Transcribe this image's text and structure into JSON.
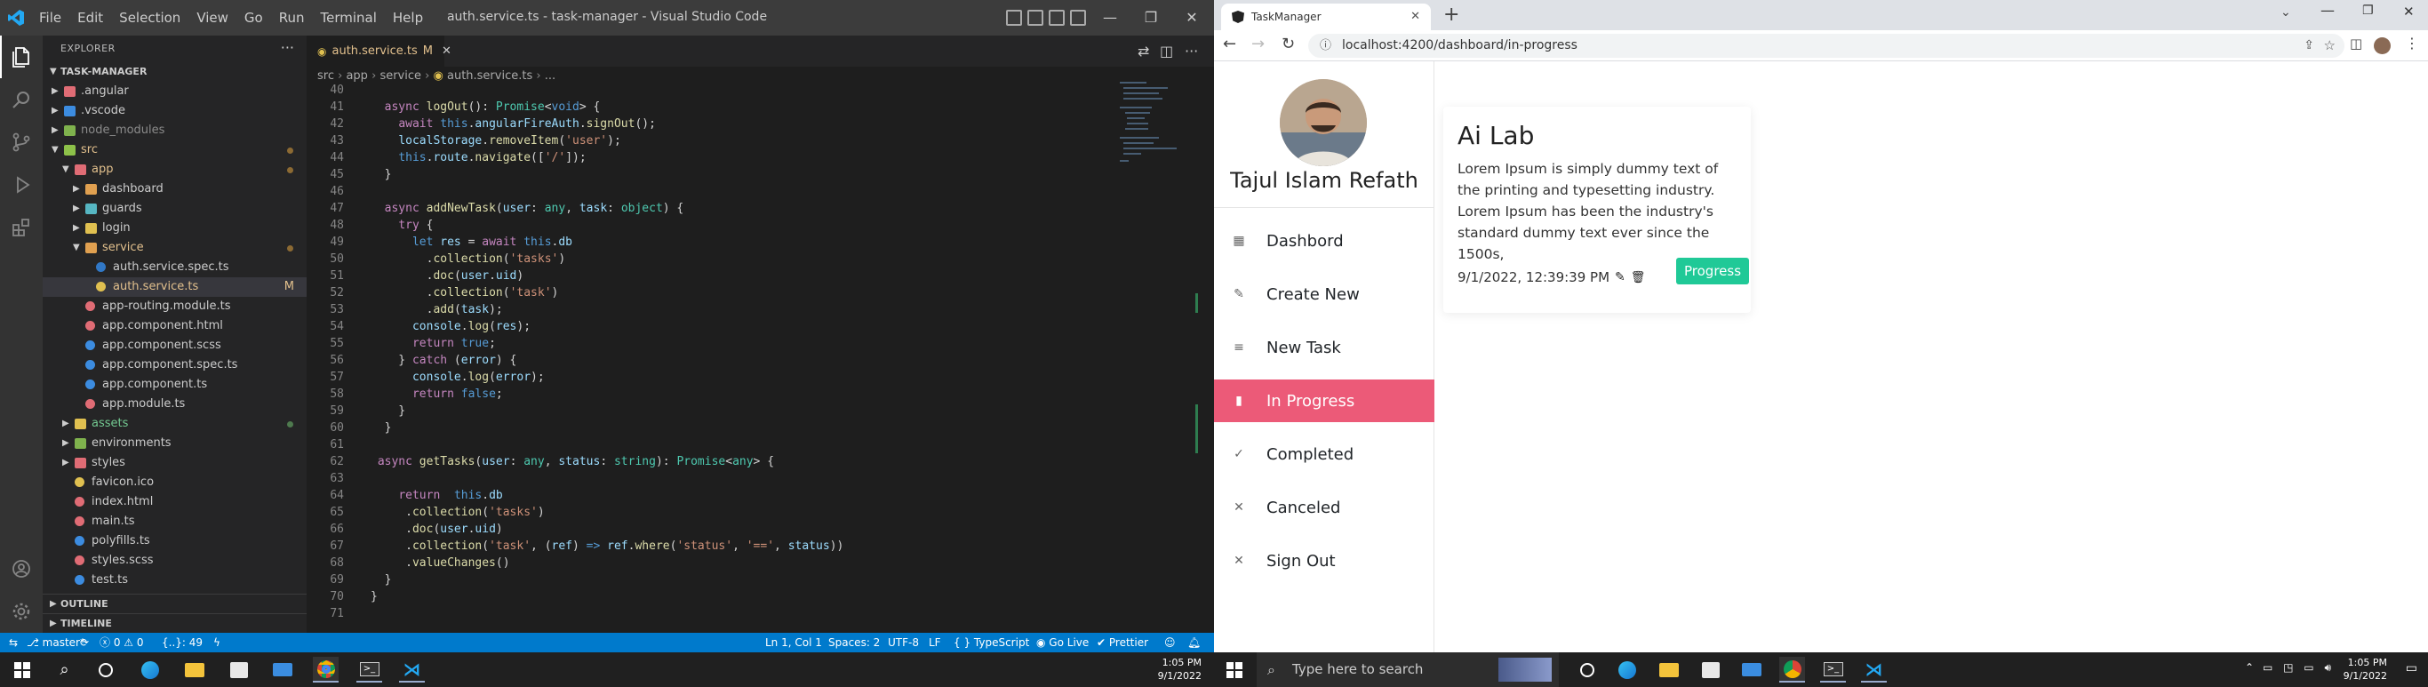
{
  "vscode": {
    "window_title": "auth.service.ts - task-manager - Visual Studio Code",
    "menu": [
      "File",
      "Edit",
      "Selection",
      "View",
      "Go",
      "Run",
      "Terminal",
      "Help"
    ],
    "explorer": {
      "header": "EXPLORER",
      "project": "TASK-MANAGER",
      "tree": [
        {
          "label": ".angular",
          "depth": 1,
          "type": "folder",
          "color": "#e06c75",
          "expanded": false
        },
        {
          "label": ".vscode",
          "depth": 1,
          "type": "folder",
          "color": "#3c8ce0",
          "expanded": false
        },
        {
          "label": "node_modules",
          "depth": 1,
          "type": "folder",
          "color": "#7fb24d",
          "expanded": false,
          "dim": true
        },
        {
          "label": "src",
          "depth": 1,
          "type": "folder",
          "color": "#8dc149",
          "expanded": true,
          "dot": "m"
        },
        {
          "label": "app",
          "depth": 2,
          "type": "folder",
          "color": "#e06c75",
          "expanded": true,
          "dot": "m"
        },
        {
          "label": "dashboard",
          "depth": 3,
          "type": "folder",
          "color": "#e0a050",
          "expanded": false
        },
        {
          "label": "guards",
          "depth": 3,
          "type": "folder",
          "color": "#56b6c2",
          "expanded": false
        },
        {
          "label": "login",
          "depth": 3,
          "type": "folder",
          "color": "#e0c050",
          "expanded": false
        },
        {
          "label": "service",
          "depth": 3,
          "type": "folder",
          "color": "#e0a050",
          "expanded": true,
          "dot": "m"
        },
        {
          "label": "auth.service.spec.ts",
          "depth": 4,
          "type": "file",
          "color": "#3178c6"
        },
        {
          "label": "auth.service.ts",
          "depth": 4,
          "type": "file",
          "color": "#e0c050",
          "modified": "M",
          "selected": true
        },
        {
          "label": "app-routing.module.ts",
          "depth": 3,
          "type": "file",
          "color": "#e06c75"
        },
        {
          "label": "app.component.html",
          "depth": 3,
          "type": "file",
          "color": "#e06c75"
        },
        {
          "label": "app.component.scss",
          "depth": 3,
          "type": "file",
          "color": "#3c8ce0"
        },
        {
          "label": "app.component.spec.ts",
          "depth": 3,
          "type": "file",
          "color": "#3c8ce0"
        },
        {
          "label": "app.component.ts",
          "depth": 3,
          "type": "file",
          "color": "#3c8ce0"
        },
        {
          "label": "app.module.ts",
          "depth": 3,
          "type": "file",
          "color": "#e06c75"
        },
        {
          "label": "assets",
          "depth": 2,
          "type": "folder",
          "color": "#e0c050",
          "expanded": false,
          "dot": "g"
        },
        {
          "label": "environments",
          "depth": 2,
          "type": "folder",
          "color": "#7fb24d",
          "expanded": false
        },
        {
          "label": "styles",
          "depth": 2,
          "type": "folder",
          "color": "#e06c75",
          "expanded": false
        },
        {
          "label": "favicon.ico",
          "depth": 2,
          "type": "file",
          "color": "#e0c050"
        },
        {
          "label": "index.html",
          "depth": 2,
          "type": "file",
          "color": "#e06c75"
        },
        {
          "label": "main.ts",
          "depth": 2,
          "type": "file",
          "color": "#e06c75"
        },
        {
          "label": "polyfills.ts",
          "depth": 2,
          "type": "file",
          "color": "#3c8ce0"
        },
        {
          "label": "styles.scss",
          "depth": 2,
          "type": "file",
          "color": "#e06c75"
        },
        {
          "label": "test.ts",
          "depth": 2,
          "type": "file",
          "color": "#3c8ce0"
        }
      ],
      "outline": "OUTLINE",
      "timeline": "TIMELINE"
    },
    "tab": {
      "label": "auth.service.ts",
      "modified": "M"
    },
    "breadcrumb": [
      "src",
      "app",
      "service",
      "auth.service.ts",
      "..."
    ],
    "code": [
      {
        "n": "40",
        "html": ""
      },
      {
        "n": "41",
        "html": "  <span class='k'>async</span> <span class='f'>logOut</span>(): <span class='t'>Promise</span>&lt;<span class='b'>void</span>&gt; {"
      },
      {
        "n": "42",
        "html": "    <span class='k'>await</span> <span class='b'>this</span>.<span class='v'>angularFireAuth</span>.<span class='f'>signOut</span>();"
      },
      {
        "n": "43",
        "html": "    <span class='v'>localStorage</span>.<span class='f'>removeItem</span>(<span class='s'>'user'</span>);"
      },
      {
        "n": "44",
        "html": "    <span class='b'>this</span>.<span class='v'>route</span>.<span class='f'>navigate</span>([<span class='s'>'/'</span>]);"
      },
      {
        "n": "45",
        "html": "  }"
      },
      {
        "n": "46",
        "html": ""
      },
      {
        "n": "47",
        "html": "  <span class='k'>async</span> <span class='f'>addNewTask</span>(<span class='v'>user</span>: <span class='t'>any</span>, <span class='v'>task</span>: <span class='t'>object</span>) {"
      },
      {
        "n": "48",
        "html": "    <span class='k'>try</span> {"
      },
      {
        "n": "49",
        "html": "      <span class='b'>let</span> <span class='v'>res</span> = <span class='k'>await</span> <span class='b'>this</span>.<span class='v'>db</span>"
      },
      {
        "n": "50",
        "html": "        .<span class='f'>collection</span>(<span class='s'>'tasks'</span>)"
      },
      {
        "n": "51",
        "html": "        .<span class='f'>doc</span>(<span class='v'>user</span>.<span class='v'>uid</span>)"
      },
      {
        "n": "52",
        "html": "        .<span class='f'>collection</span>(<span class='s'>'task'</span>)"
      },
      {
        "n": "53",
        "html": "        .<span class='f'>add</span>(<span class='v'>task</span>);"
      },
      {
        "n": "54",
        "html": "      <span class='v'>console</span>.<span class='f'>log</span>(<span class='v'>res</span>);"
      },
      {
        "n": "55",
        "html": "      <span class='k'>return</span> <span class='b'>true</span>;"
      },
      {
        "n": "56",
        "html": "    } <span class='k'>catch</span> (<span class='v'>error</span>) {"
      },
      {
        "n": "57",
        "html": "      <span class='v'>console</span>.<span class='f'>log</span>(<span class='v'>error</span>);"
      },
      {
        "n": "58",
        "html": "      <span class='k'>return</span> <span class='b'>false</span>;"
      },
      {
        "n": "59",
        "html": "    }"
      },
      {
        "n": "60",
        "html": "  }"
      },
      {
        "n": "61",
        "html": ""
      },
      {
        "n": "62",
        "html": " <span class='k'>async</span> <span class='f'>getTasks</span>(<span class='v'>user</span>: <span class='t'>any</span>, <span class='v'>status</span>: <span class='t'>string</span>): <span class='t'>Promise</span>&lt;<span class='t'>any</span>&gt; {"
      },
      {
        "n": "63",
        "html": ""
      },
      {
        "n": "64",
        "html": "    <span class='k'>return</span>  <span class='b'>this</span>.<span class='v'>db</span>"
      },
      {
        "n": "65",
        "html": "     .<span class='f'>collection</span>(<span class='s'>'tasks'</span>)"
      },
      {
        "n": "66",
        "html": "     .<span class='f'>doc</span>(<span class='v'>user</span>.<span class='v'>uid</span>)"
      },
      {
        "n": "67",
        "html": "     .<span class='f'>collection</span>(<span class='s'>'task'</span>, (<span class='v'>ref</span>) <span class='b'>=&gt;</span> <span class='v'>ref</span>.<span class='f'>where</span>(<span class='s'>'status'</span>, <span class='s'>'=='</span>, <span class='v'>status</span>))"
      },
      {
        "n": "68",
        "html": "     .<span class='f'>valueChanges</span>()"
      },
      {
        "n": "69",
        "html": "  }"
      },
      {
        "n": "70",
        "html": "}"
      },
      {
        "n": "71",
        "html": ""
      }
    ],
    "status": {
      "branch": "master*",
      "errors": "0",
      "warnings": "0",
      "selection": "{..}: 49",
      "position": "Ln 1, Col 1",
      "spaces": "Spaces: 2",
      "encoding": "UTF-8",
      "eol": "LF",
      "language": "TypeScript",
      "golive": "Go Live",
      "prettier": "Prettier"
    }
  },
  "chrome": {
    "tab_title": "TaskManager",
    "url": "localhost:4200/dashboard/in-progress"
  },
  "app": {
    "user_name": "Tajul Islam Refath",
    "nav": [
      {
        "label": "Dashbord",
        "icon": "dashboard-icon",
        "glyph": "▦",
        "active": false
      },
      {
        "label": "Create New",
        "icon": "edit-icon",
        "glyph": "✎",
        "active": false
      },
      {
        "label": "New Task",
        "icon": "list-icon",
        "glyph": "≡",
        "active": false
      },
      {
        "label": "In Progress",
        "icon": "bar-chart-icon",
        "glyph": "▮",
        "active": true
      },
      {
        "label": "Completed",
        "icon": "check-circle-icon",
        "glyph": "✓",
        "active": false
      },
      {
        "label": "Canceled",
        "icon": "cancel-circle-icon",
        "glyph": "✕",
        "active": false
      },
      {
        "label": "Sign Out",
        "icon": "sign-out-icon",
        "glyph": "✕",
        "active": false
      }
    ],
    "task": {
      "title": "Ai Lab",
      "description": "Lorem Ipsum is simply dummy text of the printing and typesetting industry. Lorem Ipsum has been the industry's standard dummy text ever since the 1500s,",
      "date": "9/1/2022, 12:39:39 PM",
      "status": "Progress"
    }
  },
  "taskbar": {
    "search_placeholder": "Type here to search",
    "time": "1:05 PM",
    "date": "9/1/2022"
  },
  "colors": {
    "active_nav": "#ec5a78",
    "status_badge": "#20c997",
    "vscode_statusbar": "#007acc"
  }
}
